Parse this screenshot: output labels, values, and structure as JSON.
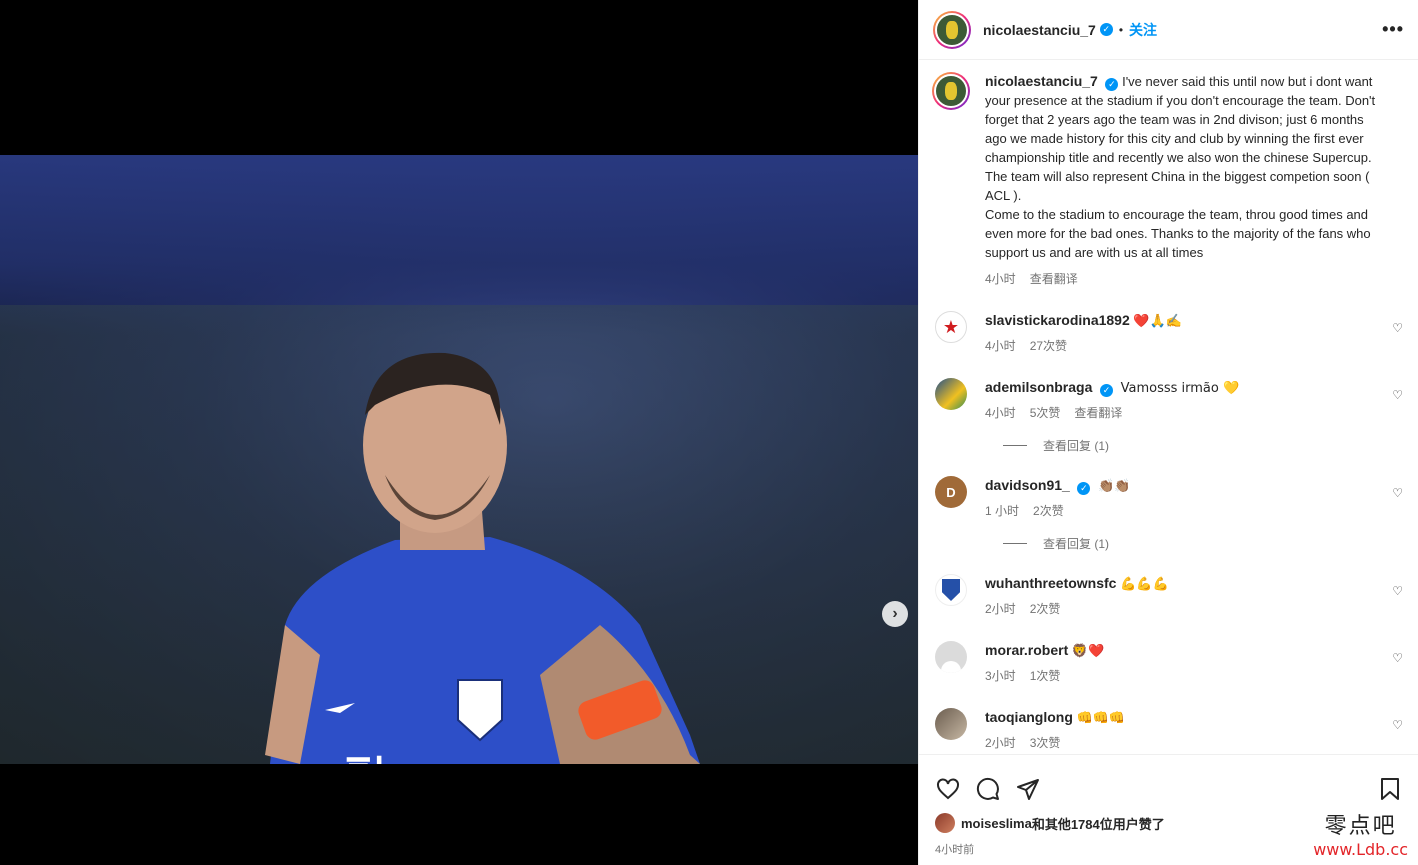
{
  "post": {
    "username": "nicolaestanciu_7",
    "follow_label": "关注",
    "more_label": "•••",
    "caption_user": "nicolaestanciu_7",
    "caption_text": "I've never said this until now but i dont want your presence at the stadium if you don't encourage the team. Don't forget that 2 years ago the team was in 2nd divison; just 6 months ago we made history for this city and club by winning the first ever championship title and recently we also won the chinese Supercup. The team will also represent China in the biggest competion soon ( ACL ).",
    "caption_text_2": "Come to the stadium to encourage the team, throu good times and even more for the bad ones. Thanks to the majority of the fans who support us and are with us at all times",
    "caption_time": "4小时",
    "caption_translate": "查看翻译"
  },
  "media": {
    "next_icon": "chevron-right-icon",
    "carousel_count": 3,
    "carousel_active": 1
  },
  "comments": [
    {
      "user": "slavistickarodina1892",
      "text": "❤️🙏✍️",
      "time": "4小时",
      "likes": "27次赞",
      "verified": false
    },
    {
      "user": "ademilsonbraga",
      "text": "Vamosss irmão 💛",
      "time": "4小时",
      "likes": "5次赞",
      "translate": "查看翻译",
      "replies": "查看回复 (1)",
      "verified": true
    },
    {
      "user": "davidson91_",
      "text": "👏🏽👏🏽",
      "time": "1 小时",
      "likes": "2次赞",
      "replies": "查看回复 (1)",
      "verified": true
    },
    {
      "user": "wuhanthreetownsfc",
      "text": "💪💪💪",
      "time": "2小时",
      "likes": "2次赞",
      "verified": false
    },
    {
      "user": "morar.robert",
      "text": "🦁❤️",
      "time": "3小时",
      "likes": "1次赞",
      "verified": false
    },
    {
      "user": "taoqianglong",
      "text": "👊👊👊",
      "time": "2小时",
      "likes": "3次赞",
      "verified": false
    }
  ],
  "footer": {
    "liked_by_user": "moiseslima",
    "liked_by_rest": "和其他1784位用户赞了",
    "timestamp": "4小时前"
  },
  "watermark": {
    "cn": "零点吧",
    "url": "www.Ldb.cc"
  },
  "colors": {
    "accent": "#0095f6",
    "muted": "#737373",
    "text": "#262626"
  }
}
